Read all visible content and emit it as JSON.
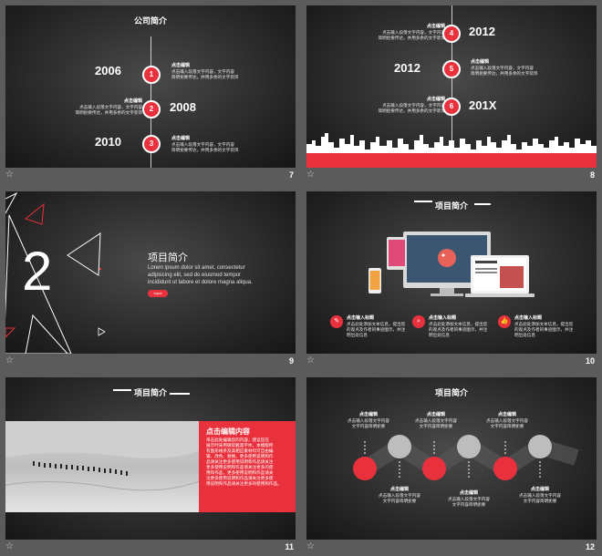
{
  "colors": {
    "accent": "#e8313c",
    "background": "#5b5b5b",
    "slide_dark": "#1c1c1c"
  },
  "slides": [
    {
      "number": "7",
      "title": "公司简介",
      "events": [
        {
          "year": "2006",
          "badge": "1",
          "heading": "点击编辑",
          "text1": "点击输入段落文字内容，文字内容",
          "text2": "简明扼要传达，并用多余的文字装饰"
        },
        {
          "year": "2008",
          "badge": "2",
          "heading": "点击编辑",
          "text1": "点击输入段落文字内容，文字内容",
          "text2": "简明扼要传达，并用多余的文字装饰"
        },
        {
          "year": "2010",
          "badge": "3",
          "heading": "点击编辑",
          "text1": "点击输入段落文字内容，文字内容",
          "text2": "简明扼要传达，并用多余的文字装饰"
        }
      ]
    },
    {
      "number": "8",
      "events": [
        {
          "year": "2012",
          "badge": "4",
          "heading": "点击编辑",
          "text1": "点击输入段落文字内容，文字内容",
          "text2": "简明扼要传达，并用多余的文字装饰"
        },
        {
          "year": "2012",
          "badge": "5",
          "heading": "点击编辑",
          "text1": "点击输入段落文字内容，文字内容",
          "text2": "简明扼要传达，并用多余的文字装饰"
        },
        {
          "year": "201X",
          "badge": "6",
          "heading": "点击编辑",
          "text1": "点击输入段落文字内容，文字内容",
          "text2": "简明扼要传达，并用多余的文字装饰"
        }
      ]
    },
    {
      "number": "9",
      "big_number": "2",
      "title": "项目简介",
      "lorem1": "Lorem ipsum dolor sit amet, consectetur",
      "lorem2": "adipiscing elit, sed do eiusmod tempor",
      "lorem3": "incididunt ut labore et dolore magna aliqua.",
      "button": "Input"
    },
    {
      "number": "10",
      "title": "项目简介",
      "features": [
        {
          "icon": "tag-icon",
          "heading": "点击输入标题",
          "text1": "点击此处添加文本信息，提出您",
          "text2": "的观点及作者的事迹图示，并注",
          "text3": "明出处信息"
        },
        {
          "icon": "search-icon",
          "heading": "点击输入标题",
          "text1": "点击此处添加文本信息，提出您",
          "text2": "的观点及作者的事迹图示，并注",
          "text3": "明出处信息"
        },
        {
          "icon": "thumbs-up-icon",
          "heading": "点击输入标题",
          "text1": "点击此处添加文本信息，提出您",
          "text2": "的观点及作者的事迹图示，并注",
          "text3": "明出处信息"
        }
      ]
    },
    {
      "number": "11",
      "title": "项目简介",
      "panel_heading": "点击编辑内容",
      "panel_lines": [
        "单击此处编辑您的内容，建议您在",
        "展示时采用微软雅黑字体，本模版所",
        "有图形线条及其相应素材均可自由编",
        "辑、改色、替换。更多使用说明和作",
        "品请关注更多使用说明和作品请关注",
        "更多使用说明和作品请关注更多的使",
        "用和作品，更多使用说明和作品请关",
        "注更多使用说明和作品请关注更多使",
        "用说明和作品请关注更多的使用和作品。"
      ]
    },
    {
      "number": "12",
      "title": "项目简介",
      "callouts": [
        {
          "heading": "点击编辑",
          "text1": "点击输入段落文字内容",
          "text2": "文字内容简明扼要"
        },
        {
          "heading": "点击编辑",
          "text1": "点击输入段落文字内容",
          "text2": "文字内容简明扼要"
        },
        {
          "heading": "点击编辑",
          "text1": "点击输入段落文字内容",
          "text2": "文字内容简明扼要"
        },
        {
          "heading": "点击编辑",
          "text1": "点击输入段落文字内容",
          "text2": "文字内容简明扼要"
        },
        {
          "heading": "点击编辑",
          "text1": "点击输入段落文字内容",
          "text2": "文字内容简明扼要"
        },
        {
          "heading": "点击编辑",
          "text1": "点击输入段落文字内容",
          "text2": "文字内容简明扼要"
        }
      ]
    }
  ],
  "star_icon": "star-icon"
}
